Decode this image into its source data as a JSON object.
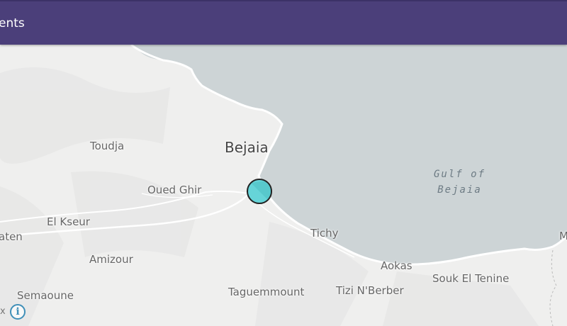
{
  "header": {
    "title": "ents"
  },
  "map": {
    "colors": {
      "land": "#efefee",
      "sea": "#cdd4d6",
      "coast": "#ffffff",
      "marker": "#66d4d8",
      "header": "#4b3f7a"
    },
    "places": {
      "toudja": "Toudja",
      "bejaia": "Bejaia",
      "oued_ghir": "Oued Ghir",
      "el_kseur": "El Kseur",
      "aten": "aten",
      "tichy": "Tichy",
      "amizour": "Amizour",
      "aokas": "Aokas",
      "souk_el_tenine": "Souk El Tenine",
      "semaoune": "Semaoune",
      "taguemmount": "Taguemmount",
      "tizi_n_berber": "Tizi N'Berber",
      "edge_m": "M"
    },
    "water": {
      "line1": "Gulf of",
      "line2": "Bejaia"
    },
    "marker": {
      "icon": "event-circle-marker"
    },
    "attribution": {
      "close_glyph": "x",
      "info_glyph": "i"
    }
  }
}
